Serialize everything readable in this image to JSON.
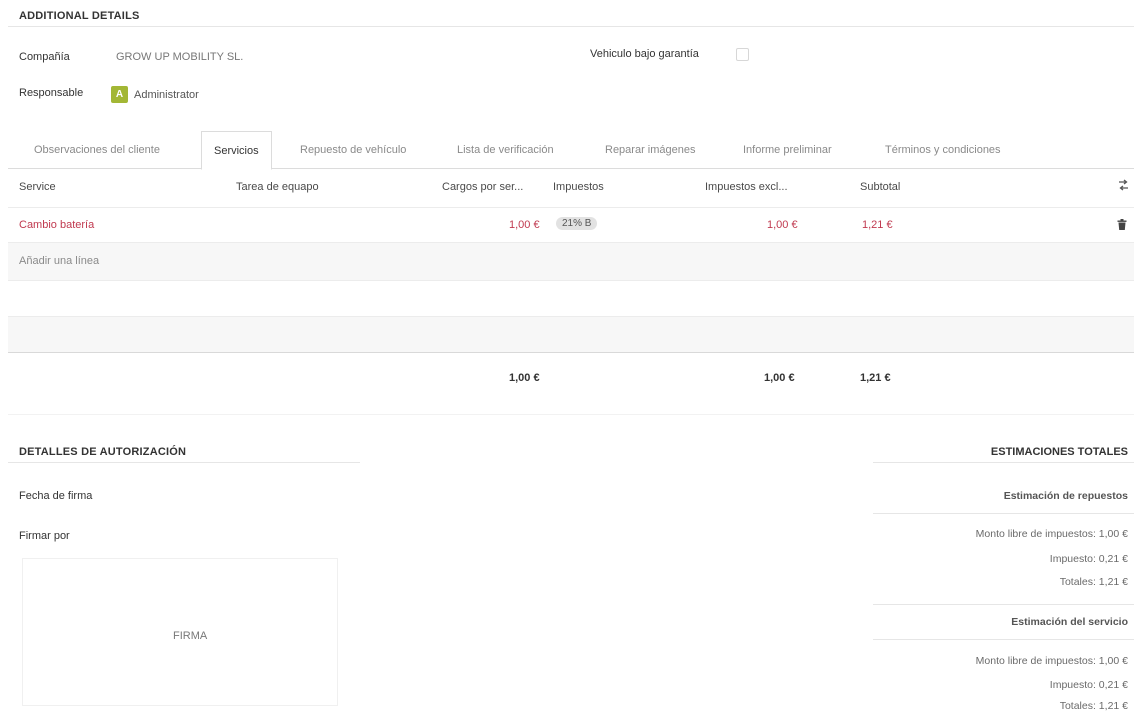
{
  "additional": {
    "title": "ADDITIONAL DETAILS",
    "company_label": "Compañía",
    "company_value": "GROW UP MOBILITY SL.",
    "warranty_label": "Vehiculo bajo garantía",
    "responsible_label": "Responsable",
    "responsible_avatar": "A",
    "responsible_value": "Administrator"
  },
  "tabs": [
    {
      "label": "Observaciones del cliente"
    },
    {
      "label": "Servicios"
    },
    {
      "label": "Repuesto de vehículo"
    },
    {
      "label": "Lista de verificación"
    },
    {
      "label": "Reparar imágenes"
    },
    {
      "label": "Informe preliminar"
    },
    {
      "label": "Términos y condiciones"
    }
  ],
  "table": {
    "headers": {
      "service": "Service",
      "task": "Tarea de equapo",
      "charges": "Cargos por ser...",
      "taxes": "Impuestos",
      "taxes_excl": "Impuestos excl...",
      "subtotal": "Subtotal"
    },
    "rows": [
      {
        "service": "Cambio batería",
        "task": "",
        "charges": "1,00 €",
        "tax_badge": "21% B",
        "taxes_excl": "1,00 €",
        "subtotal": "1,21 €"
      }
    ],
    "add_line": "Añadir una línea",
    "totals": {
      "charges": "1,00 €",
      "taxes_excl": "1,00 €",
      "subtotal": "1,21 €"
    }
  },
  "authorization": {
    "title": "DETALLES DE AUTORIZACIÓN",
    "date_label": "Fecha de firma",
    "signed_by_label": "Firmar por",
    "signature_placeholder": "FIRMA"
  },
  "estimations": {
    "title": "ESTIMACIONES TOTALES",
    "parts": {
      "title": "Estimación de repuestos",
      "untaxed": "Monto libre de impuestos: 1,00 €",
      "tax": "Impuesto: 0,21 €",
      "total": "Totales: 1,21 €"
    },
    "service": {
      "title": "Estimación del servicio",
      "untaxed": "Monto libre de impuestos: 1,00 €",
      "tax": "Impuesto: 0,21 €",
      "total": "Totales: 1,21 €"
    }
  },
  "icons": {
    "columns_toggle": "column-settings-icon",
    "delete": "trash-icon"
  },
  "colors": {
    "avatar_bg": "#a3b735",
    "row_accent": "#c0394f"
  }
}
